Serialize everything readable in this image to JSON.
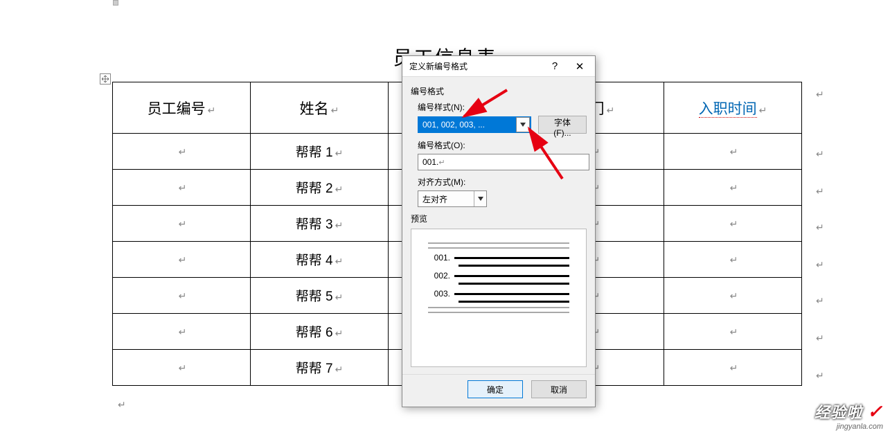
{
  "doc": {
    "title": "员工信息表",
    "headers": [
      "员工编号",
      "姓名",
      "",
      "部门",
      "入职时间"
    ],
    "rows": [
      [
        "",
        "帮帮 1",
        "",
        "",
        ""
      ],
      [
        "",
        "帮帮 2",
        "",
        "",
        ""
      ],
      [
        "",
        "帮帮 3",
        "",
        "",
        ""
      ],
      [
        "",
        "帮帮 4",
        "",
        "",
        ""
      ],
      [
        "",
        "帮帮 5",
        "",
        "",
        ""
      ],
      [
        "",
        "帮帮 6",
        "",
        "",
        ""
      ],
      [
        "",
        "帮帮 7",
        "",
        "",
        ""
      ]
    ]
  },
  "dialog": {
    "title": "定义新编号格式",
    "group_format": "编号格式",
    "label_style": "编号样式(N):",
    "style_value": "001, 002, 003, ...",
    "btn_font": "字体(F)...",
    "label_format": "编号格式(O):",
    "format_value": "001.",
    "label_align": "对齐方式(M):",
    "align_value": "左对齐",
    "group_preview": "预览",
    "preview_items": [
      "001.",
      "002.",
      "003."
    ],
    "btn_ok": "确定",
    "btn_cancel": "取消"
  },
  "watermark": {
    "line1": "经验啦",
    "line2": "jingyanla.com"
  }
}
